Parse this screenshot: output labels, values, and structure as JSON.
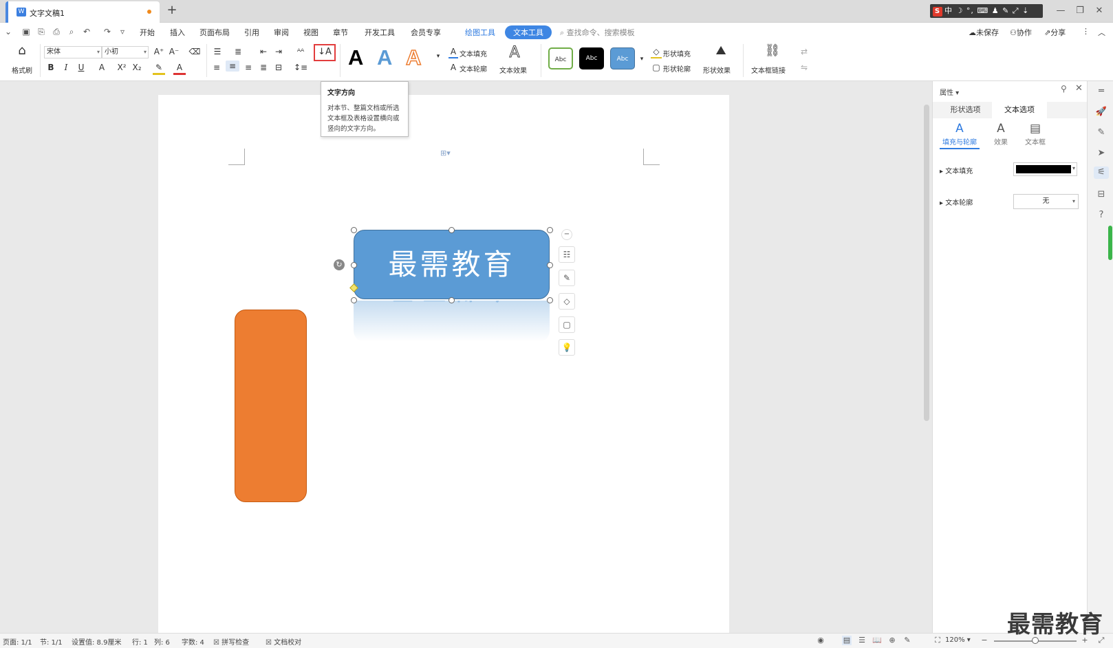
{
  "titlebar": {
    "doc_tab_label": "文字文稿1",
    "new_tab": "+",
    "ime_text": "中 ☽ °, ⌨ ♟ ✎ ⤢ ⇣",
    "win_min": "—",
    "win_max": "❐",
    "win_close": "✕"
  },
  "menubar": {
    "items": [
      "开始",
      "插入",
      "页面布局",
      "引用",
      "审阅",
      "视图",
      "章节",
      "开发工具",
      "会员专享"
    ],
    "context_tools": [
      "绘图工具",
      "文本工具"
    ],
    "search_placeholder": "查找命令、搜索模板",
    "right_actions": [
      "未保存",
      "协作",
      "分享"
    ]
  },
  "ribbon": {
    "format_painter": "格式刷",
    "font_name": "宋体",
    "font_size": "小初",
    "text_fill": "文本填充",
    "text_outline": "文本轮廓",
    "text_effects": "文本效果",
    "shape_fill": "形状填充",
    "shape_outline": "形状轮廓",
    "shape_effects": "形状效果",
    "textbox_link": "文本框链接",
    "style_sample": "Abc",
    "big_a": "A"
  },
  "tooltip": {
    "title": "文字方向",
    "body": "对本节、整篇文档或所选文本框及表格设置横向或竖向的文字方向。"
  },
  "canvas": {
    "blue_shape_text": "最需教育",
    "colors": {
      "blue": "#5b9bd5",
      "orange": "#ed7d31"
    }
  },
  "panel": {
    "title": "属性",
    "tabs": [
      "形状选项",
      "文本选项"
    ],
    "subtabs": [
      "填充与轮廓",
      "效果",
      "文本框"
    ],
    "text_fill_label": "文本填充",
    "text_outline_label": "文本轮廓",
    "text_outline_value": "无",
    "fill_color": "#000000"
  },
  "statusbar": {
    "page": "页面: 1/1",
    "section": "节: 1/1",
    "setting": "设置值: 8.9厘米",
    "row": "行: 1",
    "col": "列: 6",
    "words": "字数: 4",
    "spellcheck": "拼写检查",
    "doc_check": "文档校对",
    "zoom": "120%"
  },
  "watermark": "最需教育"
}
